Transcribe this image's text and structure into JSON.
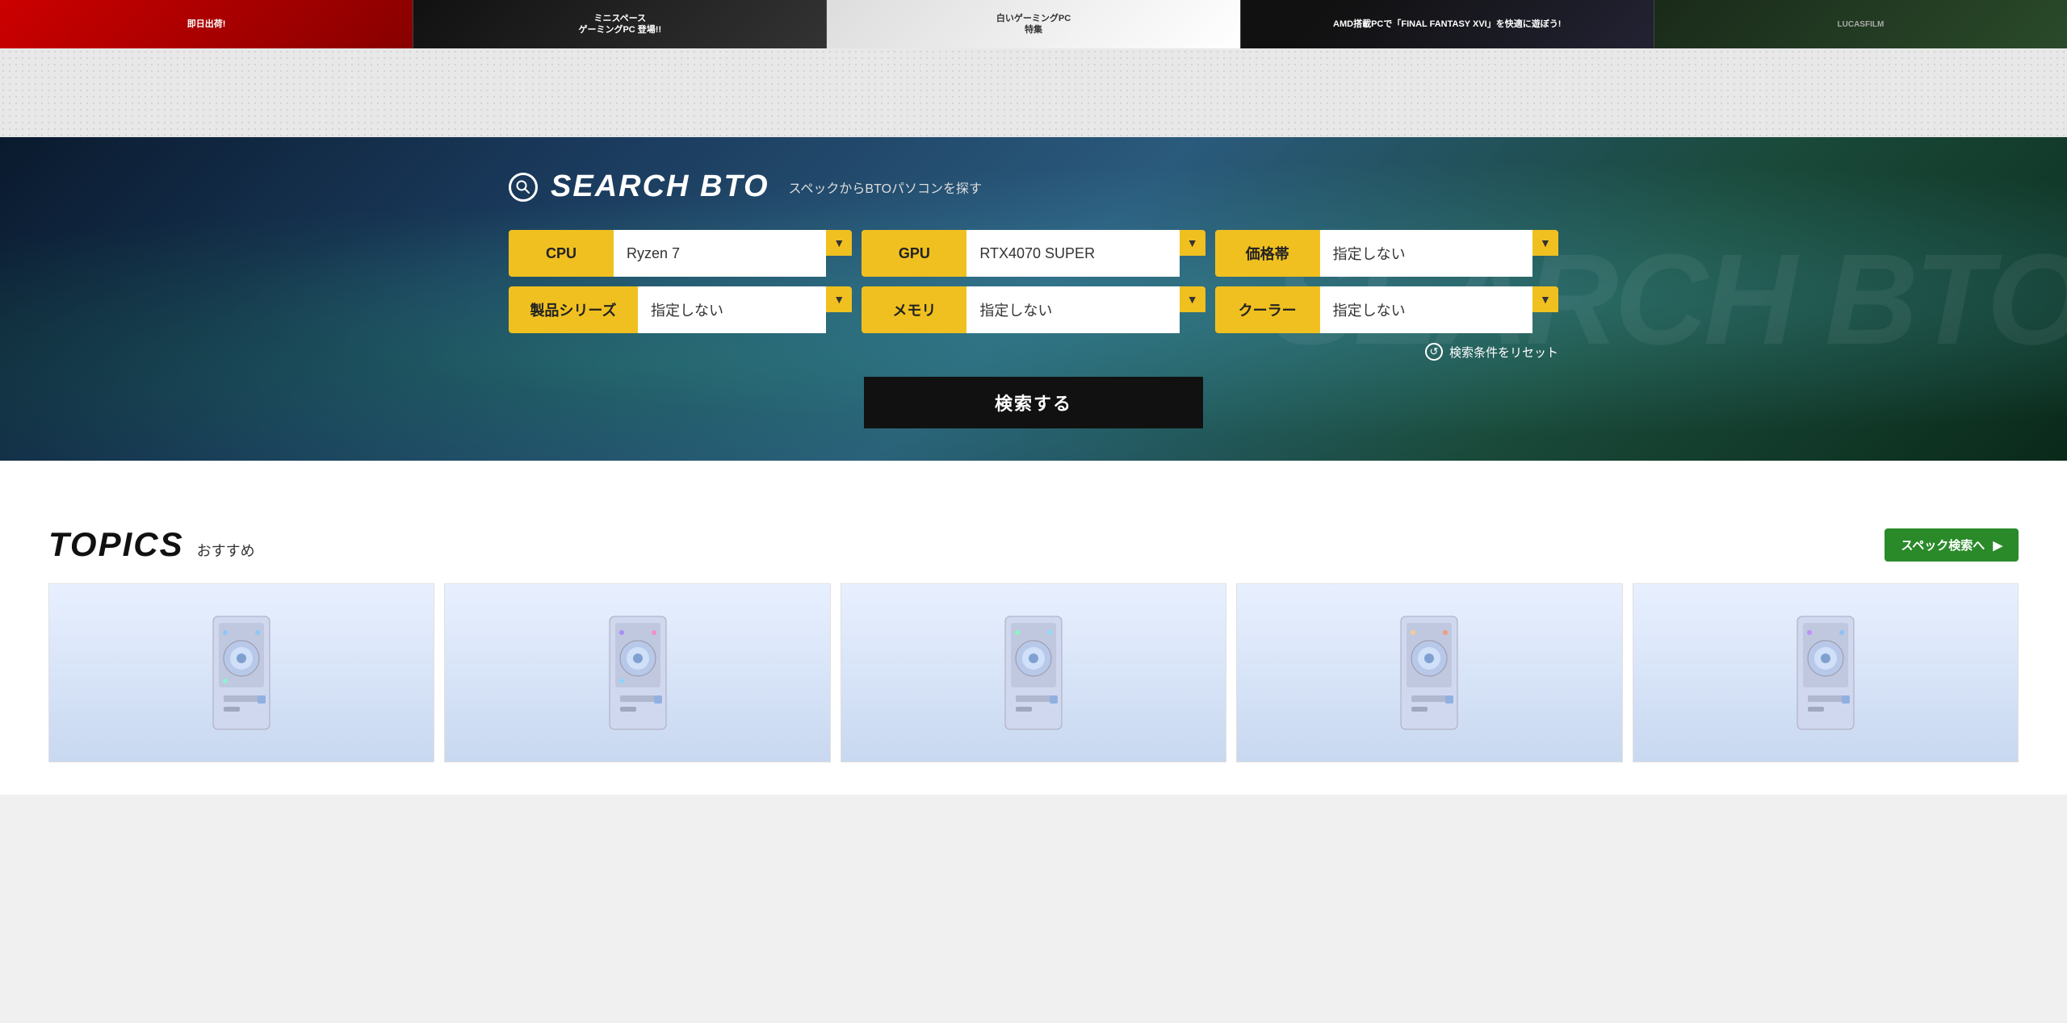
{
  "banners": [
    {
      "id": "banner-1",
      "text": "即日出荷!",
      "class": "banner-item-1"
    },
    {
      "id": "banner-2",
      "text": "ミニスペース\nゲーミングPC 登場!!",
      "class": "banner-item-2"
    },
    {
      "id": "banner-3",
      "text": "白いゲーミングPC\n特集",
      "class": "banner-item-3"
    },
    {
      "id": "banner-4",
      "text": "AMD搭載PCで「FINAL FANTASY XVI」を快適に遊ぼう!",
      "class": "banner-item-4"
    },
    {
      "id": "banner-5",
      "text": "LUCASFILM",
      "class": "banner-item-5"
    }
  ],
  "searchBto": {
    "iconLabel": "🔍",
    "title": "SEARCH BTO",
    "subtitle": "スペックからBTOパソコンを探す",
    "watermark": "SEARCH BTO",
    "filters": {
      "row1": [
        {
          "id": "cpu-filter",
          "label": "CPU",
          "value": "Ryzen 7",
          "labelClass": ""
        },
        {
          "id": "gpu-filter",
          "label": "GPU",
          "value": "RTX4070 SUPER",
          "labelClass": ""
        },
        {
          "id": "price-filter",
          "label": "価格帯",
          "value": "指定しない",
          "labelClass": ""
        }
      ],
      "row2": [
        {
          "id": "series-filter",
          "label": "製品シリーズ",
          "value": "指定しない",
          "labelClass": "filter-label-wide"
        },
        {
          "id": "memory-filter",
          "label": "メモリ",
          "value": "指定しない",
          "labelClass": ""
        },
        {
          "id": "cooler-filter",
          "label": "クーラー",
          "value": "指定しない",
          "labelClass": ""
        }
      ]
    },
    "resetLabel": "検索条件をリセット",
    "searchButtonLabel": "検索する"
  },
  "topics": {
    "title": "TOPICS",
    "subtitle": "おすすめ",
    "specSearchLabel": "スペック検索へ",
    "specSearchArrow": "▶"
  }
}
